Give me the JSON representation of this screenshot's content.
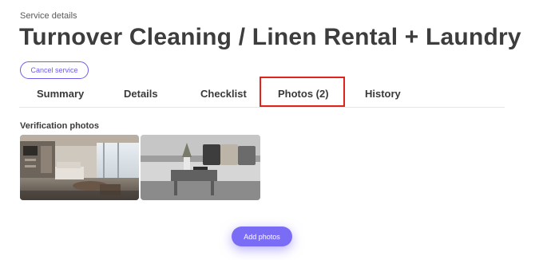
{
  "header": {
    "eyebrow": "Service details",
    "title": "Turnover Cleaning / Linen Rental + Laundry",
    "cancel_label": "Cancel service"
  },
  "tabs": [
    {
      "label": "Summary"
    },
    {
      "label": "Details"
    },
    {
      "label": "Checklist"
    },
    {
      "label": "Photos (2)",
      "active": true
    },
    {
      "label": "History"
    }
  ],
  "photos": {
    "section_label": "Verification photos",
    "items": [
      {
        "description": "living-room-interior"
      },
      {
        "description": "sofa-with-pillows"
      }
    ]
  },
  "actions": {
    "add_photos_label": "Add photos"
  },
  "colors": {
    "accent": "#7b6cf6",
    "highlight_border": "#e0231b"
  }
}
